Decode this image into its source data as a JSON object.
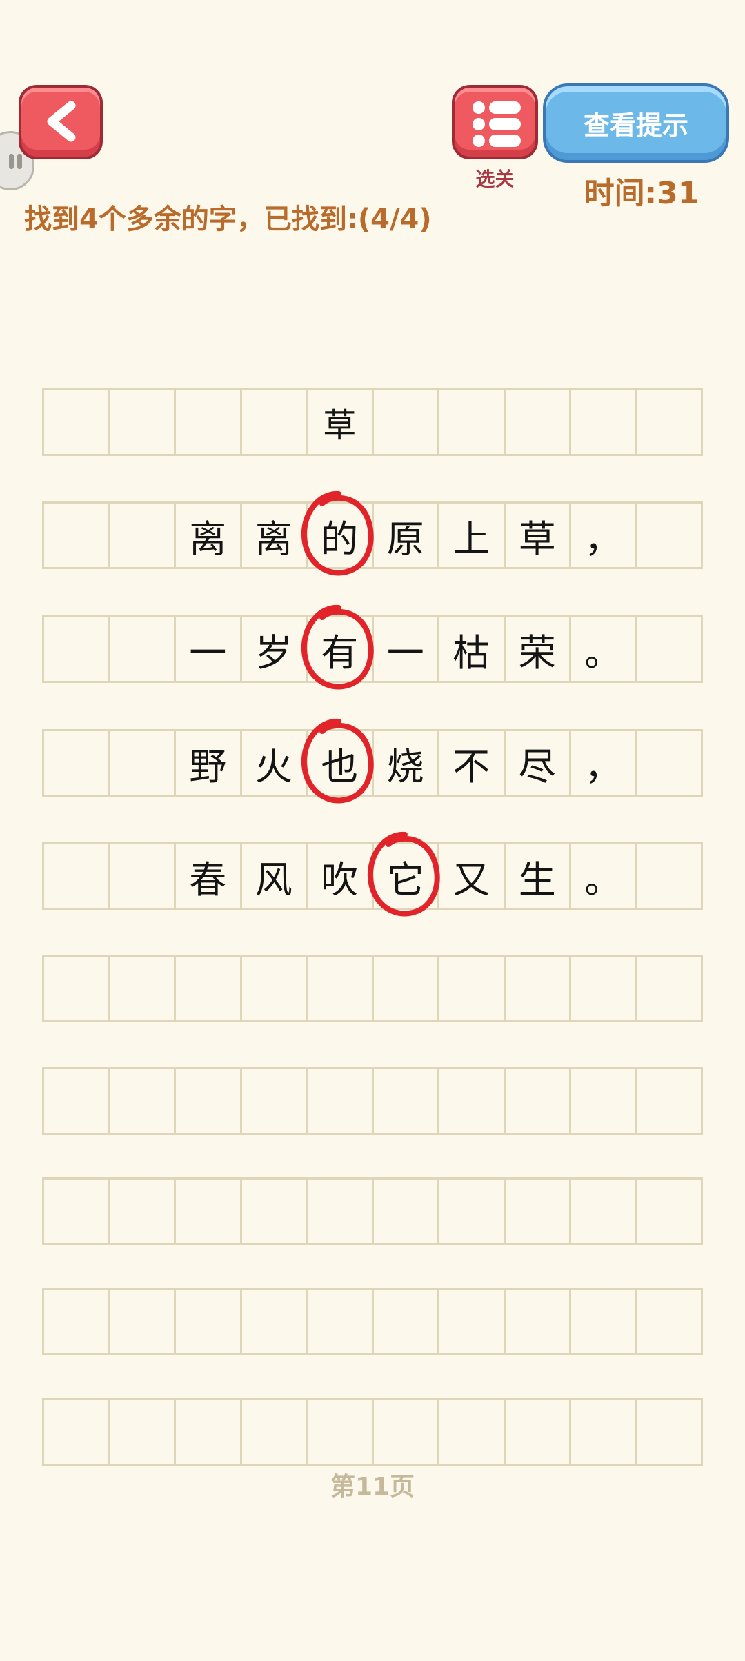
{
  "header": {
    "menu_label": "选关",
    "hint_label": "查看提示",
    "timer_text": "时间:31",
    "instruction": "找到4个多余的字，已找到:(4/4)"
  },
  "poem": {
    "rows": [
      [
        "",
        "",
        "",
        "",
        "草",
        "",
        "",
        "",
        "",
        ""
      ],
      [
        "",
        "",
        "离",
        "离",
        "的",
        "原",
        "上",
        "草",
        "，",
        ""
      ],
      [
        "",
        "",
        "一",
        "岁",
        "有",
        "一",
        "枯",
        "荣",
        "。",
        ""
      ],
      [
        "",
        "",
        "野",
        "火",
        "也",
        "烧",
        "不",
        "尽",
        "，",
        ""
      ],
      [
        "",
        "",
        "春",
        "风",
        "吹",
        "它",
        "又",
        "生",
        "。",
        ""
      ],
      [
        "",
        "",
        "",
        "",
        "",
        "",
        "",
        "",
        "",
        ""
      ],
      [
        "",
        "",
        "",
        "",
        "",
        "",
        "",
        "",
        "",
        ""
      ],
      [
        "",
        "",
        "",
        "",
        "",
        "",
        "",
        "",
        "",
        ""
      ],
      [
        "",
        "",
        "",
        "",
        "",
        "",
        "",
        "",
        "",
        ""
      ],
      [
        "",
        "",
        "",
        "",
        "",
        "",
        "",
        "",
        "",
        ""
      ]
    ],
    "found_marks": [
      {
        "row": 1,
        "col": 4,
        "char": "的"
      },
      {
        "row": 2,
        "col": 4,
        "char": "有"
      },
      {
        "row": 3,
        "col": 4,
        "char": "也"
      },
      {
        "row": 4,
        "col": 5,
        "char": "它"
      }
    ]
  },
  "footer": {
    "page_label": "第11页"
  },
  "colors": {
    "background": "#fcf8ec",
    "grid_line": "#ddd6b8",
    "accent_orange": "#b96b2c",
    "button_red": "#ee5a5f",
    "button_blue": "#6cb8e8",
    "circle_red": "#e0242a"
  },
  "icons": {
    "back": "chevron-left-icon",
    "menu": "list-icon",
    "edge": "pause-icon"
  }
}
